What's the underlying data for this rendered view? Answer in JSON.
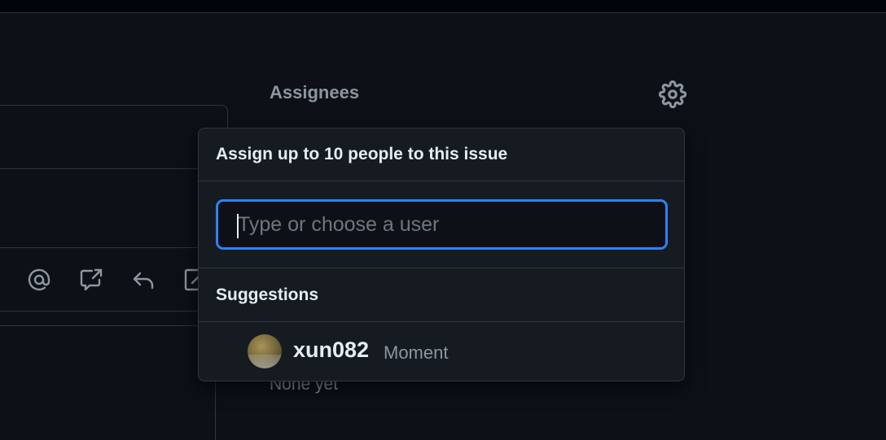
{
  "sidebar": {
    "assignees_label": "Assignees",
    "gear_icon": "gear-icon",
    "empty_text": "None yet"
  },
  "toolbar": {
    "icons": [
      "mention-icon",
      "cross-reference-icon",
      "reply-icon",
      "edit-icon"
    ]
  },
  "popover": {
    "title": "Assign up to 10 people to this issue",
    "filter_placeholder": "Type or choose a user",
    "filter_value": "",
    "suggestions_title": "Suggestions",
    "suggestions": [
      {
        "login": "xun082",
        "name": "Moment",
        "avatar": "avatar-icon"
      }
    ]
  },
  "colors": {
    "background": "#0d1117",
    "panel": "#161b22",
    "border": "#30363d",
    "accent": "#2f81f7",
    "muted": "#8d96a0"
  }
}
